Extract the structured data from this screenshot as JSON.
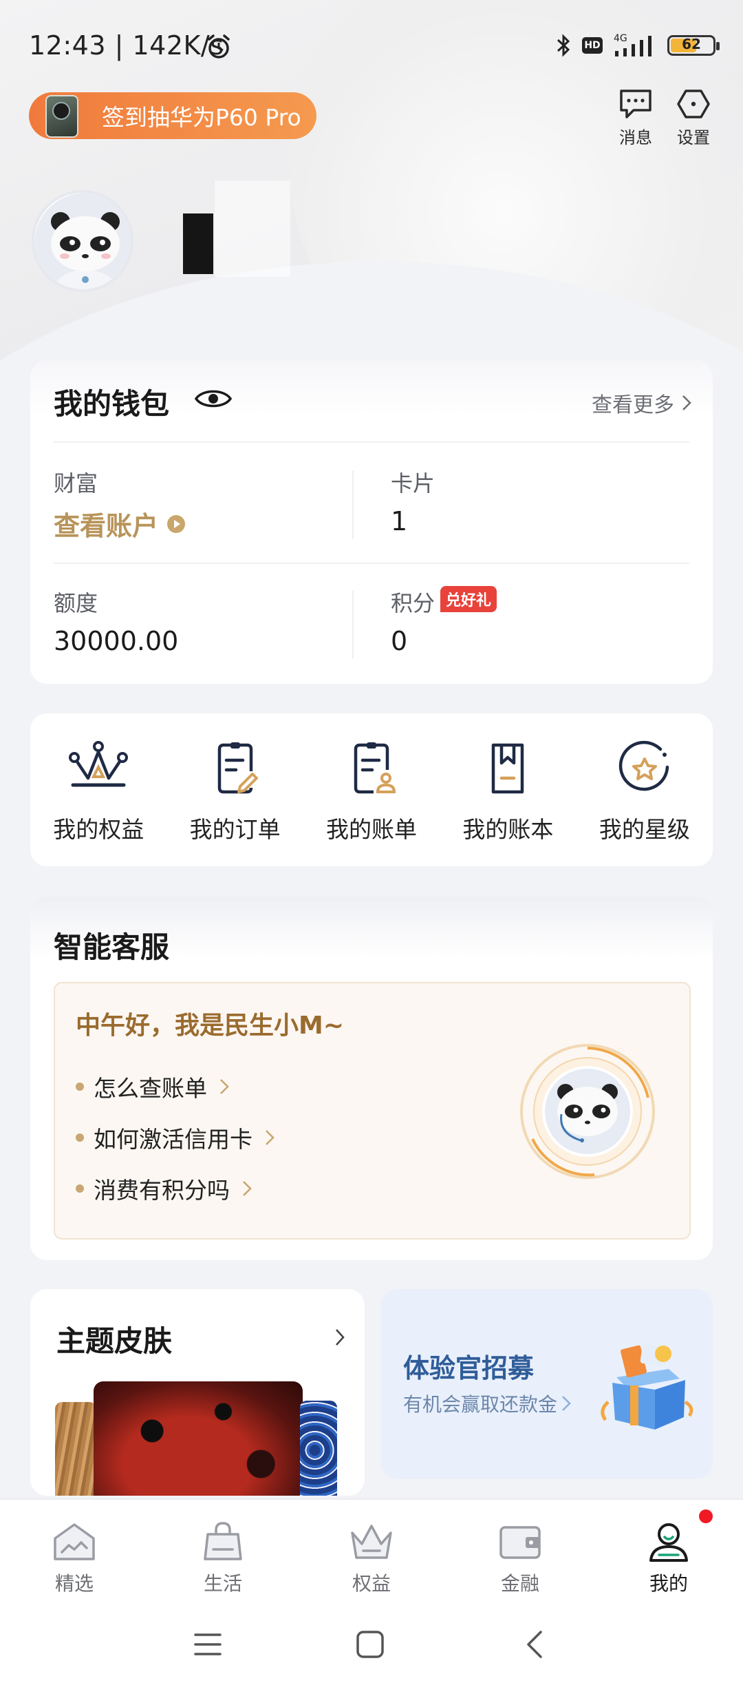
{
  "status_bar": {
    "time": "12:43 | 142K/s",
    "network": "4G",
    "battery": "62",
    "battery_fraction": 0.62,
    "hd": "HD"
  },
  "header": {
    "promo_label": "签到抽华为P60 Pro",
    "messages_label": "消息",
    "settings_label": "设置"
  },
  "wallet": {
    "title": "我的钱包",
    "more_label": "查看更多",
    "wealth_label": "财富",
    "wealth_link": "查看账户",
    "cards_label": "卡片",
    "cards_value": "1",
    "limit_label": "额度",
    "limit_value": "30000.00",
    "points_label": "积分",
    "points_badge": "兑好礼",
    "points_value": "0"
  },
  "menu": {
    "items": [
      {
        "label": "我的权益",
        "icon": "crown-icon"
      },
      {
        "label": "我的订单",
        "icon": "order-icon"
      },
      {
        "label": "我的账单",
        "icon": "bill-icon"
      },
      {
        "label": "我的账本",
        "icon": "ledger-icon"
      },
      {
        "label": "我的星级",
        "icon": "star-level-icon"
      }
    ]
  },
  "customer_service": {
    "title": "智能客服",
    "greeting": "中午好，我是民生小M~",
    "questions": [
      "怎么查账单",
      "如何激活信用卡",
      "消费有积分吗"
    ]
  },
  "theme_skin": {
    "title": "主题皮肤"
  },
  "promo_card": {
    "title": "体验官招募",
    "subtitle": "有机会赢取还款金"
  },
  "bottom_nav": {
    "items": [
      {
        "label": "精选",
        "icon": "home-icon",
        "active": false
      },
      {
        "label": "生活",
        "icon": "shopping-bag-icon",
        "active": false
      },
      {
        "label": "权益",
        "icon": "crown-icon",
        "active": false
      },
      {
        "label": "金融",
        "icon": "wallet-icon",
        "active": false
      },
      {
        "label": "我的",
        "icon": "profile-icon",
        "active": true
      }
    ]
  },
  "colors": {
    "accent_gold": "#b8945a",
    "promo_orange": "#f07a3c",
    "badge_red": "#e8423b",
    "blue_title": "#2f5d99"
  }
}
